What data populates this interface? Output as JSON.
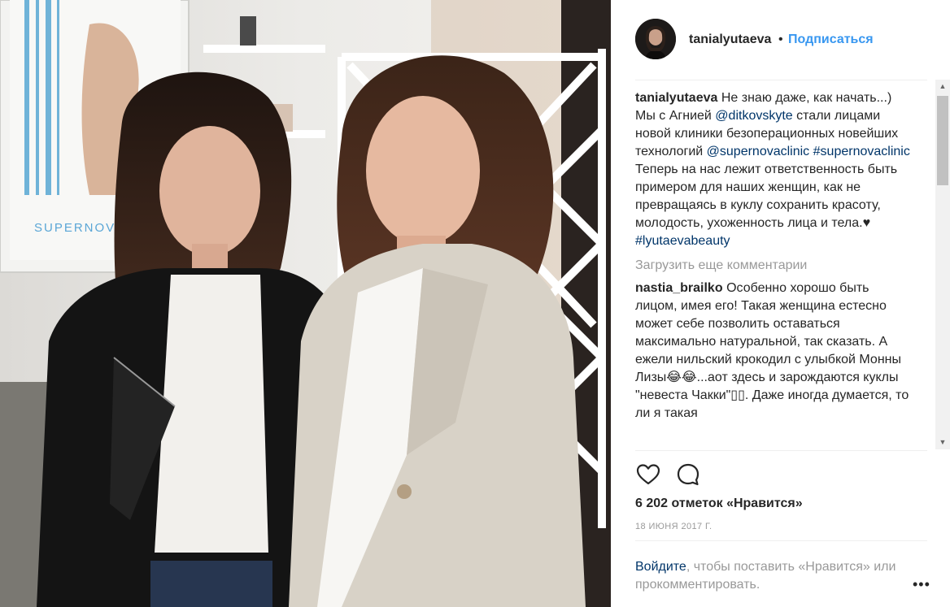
{
  "post": {
    "username": "tanialyutaeva",
    "dot": "•",
    "follow_label": "Подписаться",
    "caption": {
      "username": "tanialyutaeva",
      "text_1": "Не знаю даже, как начать...) Мы с Агнией",
      "mention_1": "@ditkovskyte",
      "text_2": "стали лицами новой клиники безоперационных новейших технологий",
      "mention_2": "@supernovaclinic",
      "hashtag_1": "#supernovaclinic",
      "text_3": "Теперь на нас лежит ответственность быть примером для наших женщин, как не превращаясь в куклу сохранить красоту, молодость, ухоженность лица и тела.♥",
      "hashtag_2": "#lyutaevabeauty"
    },
    "load_more": "Загрузить еще комментарии",
    "comment": {
      "username": "nastia_brailko",
      "text": "Особенно хорошо быть лицом, имея его! Такая женщина естесно может себе позволить оставаться максимально натуральной, так сказать. А ежели нильский крокодил с улыбкой Монны Лизы😂😂...аот здесь и зарождаются куклы \"невеста Чакки\"▯▯. Даже иногда думается, то ли я такая"
    },
    "likes_text": "6 202 отметок «Нравится»",
    "date": "18 ИЮНЯ 2017 Г.",
    "login_prompt": {
      "link": "Войдите",
      "text": ", чтобы поставить «Нравится» или прокомментировать."
    },
    "more_label": "•••",
    "photo_sign": "SUPERNOVA"
  },
  "icons": [
    "heart-icon",
    "comment-icon",
    "more-options-icon"
  ],
  "colors": {
    "link": "#003569",
    "follow": "#3897f0",
    "muted": "#999999",
    "text": "#262626"
  }
}
